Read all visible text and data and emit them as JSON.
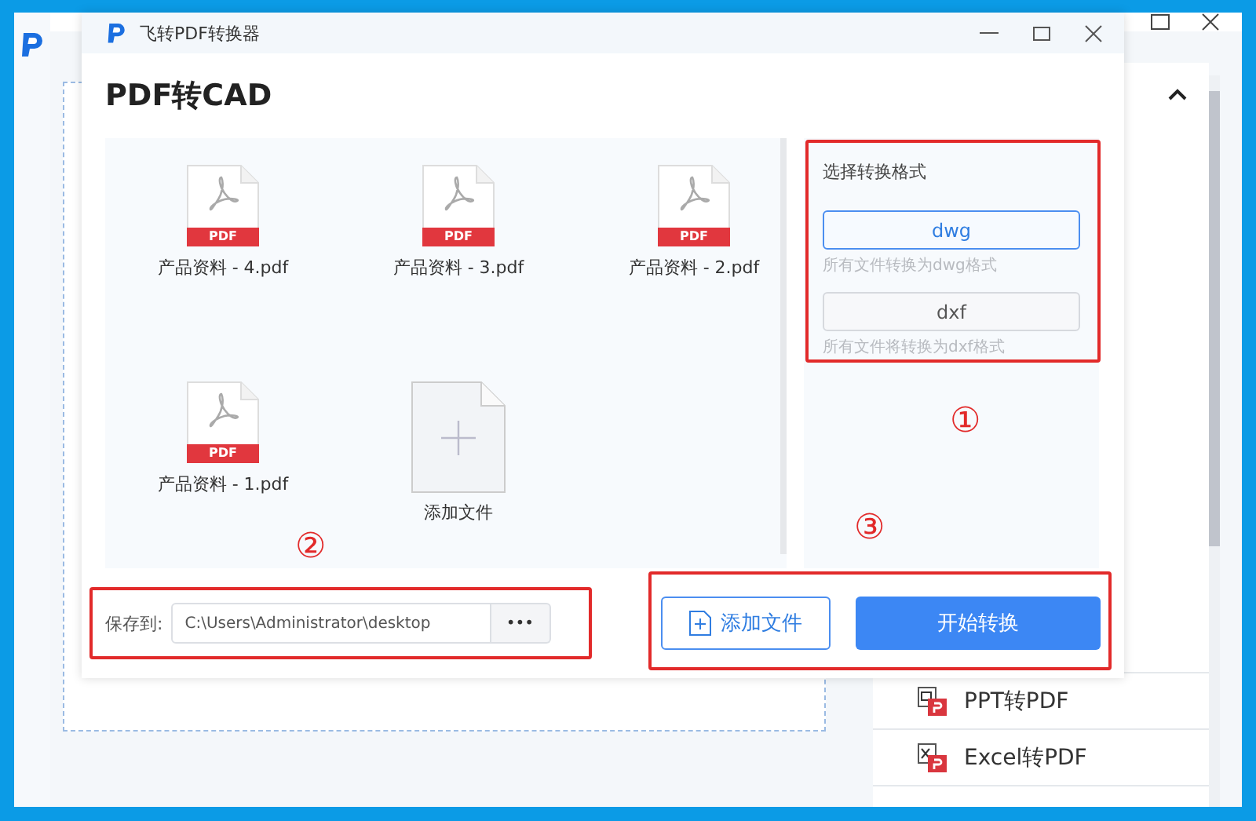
{
  "background_window": {
    "list_items": [
      {
        "label": "PPT转PDF",
        "kind": "ppt"
      },
      {
        "label": "Excel转PDF",
        "kind": "excel"
      }
    ]
  },
  "dialog": {
    "title": "飞转PDF转换器",
    "heading": "PDF转CAD",
    "files": [
      {
        "name": "产品资料 - 4.pdf",
        "kind": "pdf",
        "badge": "PDF"
      },
      {
        "name": "产品资料 - 3.pdf",
        "kind": "pdf",
        "badge": "PDF"
      },
      {
        "name": "产品资料 - 2.pdf",
        "kind": "pdf",
        "badge": "PDF"
      },
      {
        "name": "产品资料 - 1.pdf",
        "kind": "pdf",
        "badge": "PDF"
      },
      {
        "name": "添加文件",
        "kind": "add"
      }
    ],
    "format_panel": {
      "title": "选择转换格式",
      "options": [
        {
          "label": "dwg",
          "description": "所有文件转换为dwg格式",
          "selected": true
        },
        {
          "label": "dxf",
          "description": "所有文件将转换为dxf格式",
          "selected": false
        }
      ]
    },
    "save_to": {
      "label": "保存到:",
      "value": "C:\\Users\\Administrator\\desktop",
      "browse": "•••"
    },
    "buttons": [
      {
        "label": "添加文件",
        "kind": "secondary"
      },
      {
        "label": "开始转换",
        "kind": "primary"
      }
    ]
  },
  "annotations": [
    {
      "mark": "①",
      "kind": "format"
    },
    {
      "mark": "②",
      "kind": "save"
    },
    {
      "mark": "③",
      "kind": "actions"
    }
  ]
}
